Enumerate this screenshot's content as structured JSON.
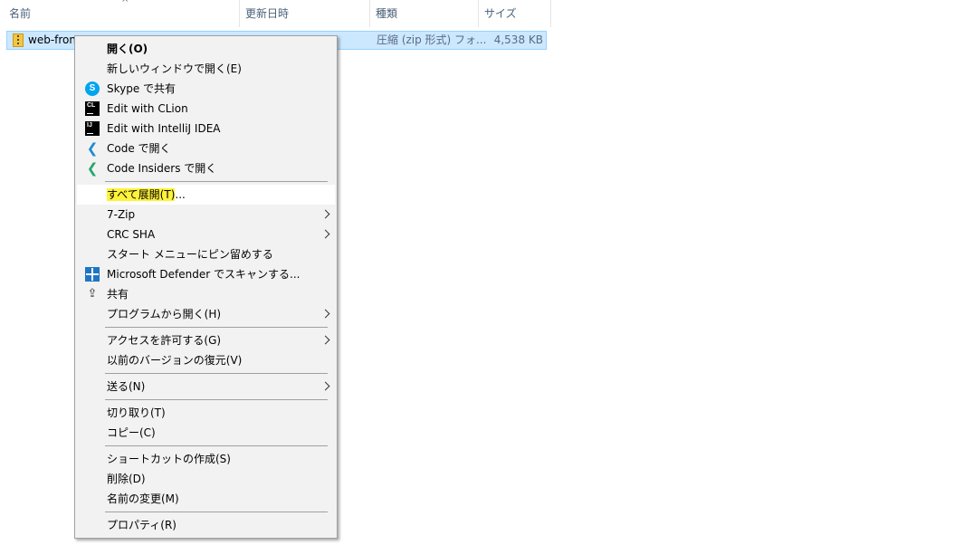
{
  "columns": {
    "name": "名前",
    "date": "更新日時",
    "type": "種類",
    "size": "サイズ"
  },
  "sort_icon": "chevron-up-icon",
  "file": {
    "name": "web-front",
    "type": "圧縮 (zip 形式) フォ...",
    "size": "4,538 KB",
    "icon": "zip-folder-icon"
  },
  "menu": {
    "open": "開く(O)",
    "open_new_window": "新しいウィンドウで開く(E)",
    "skype_share": "Skype で共有",
    "edit_clion": "Edit with CLion",
    "edit_intellij": "Edit with IntelliJ IDEA",
    "open_code": "Code で開く",
    "open_code_insiders": "Code Insiders で開く",
    "extract_all": "すべて展開(T)",
    "extract_all_suffix": "...",
    "sevenzip": "7-Zip",
    "crc_sha": "CRC SHA",
    "pin_start": "スタート メニューにピン留めする",
    "defender_scan": "Microsoft Defender でスキャンする...",
    "share": "共有",
    "open_with": "プログラムから開く(H)",
    "give_access": "アクセスを許可する(G)",
    "restore_versions": "以前のバージョンの復元(V)",
    "send_to": "送る(N)",
    "cut": "切り取り(T)",
    "copy": "コピー(C)",
    "create_shortcut": "ショートカットの作成(S)",
    "delete": "削除(D)",
    "rename": "名前の変更(M)",
    "properties": "プロパティ(R)"
  },
  "icons": {
    "skype_letter": "S",
    "clion_letters": "CL",
    "intellij_letters": "IJ",
    "vscode_glyph": "❮",
    "share_glyph": "⇪"
  },
  "colors": {
    "selection": "#cce8ff",
    "highlight": "#fff23a",
    "menu_bg": "#f2f2f2"
  }
}
